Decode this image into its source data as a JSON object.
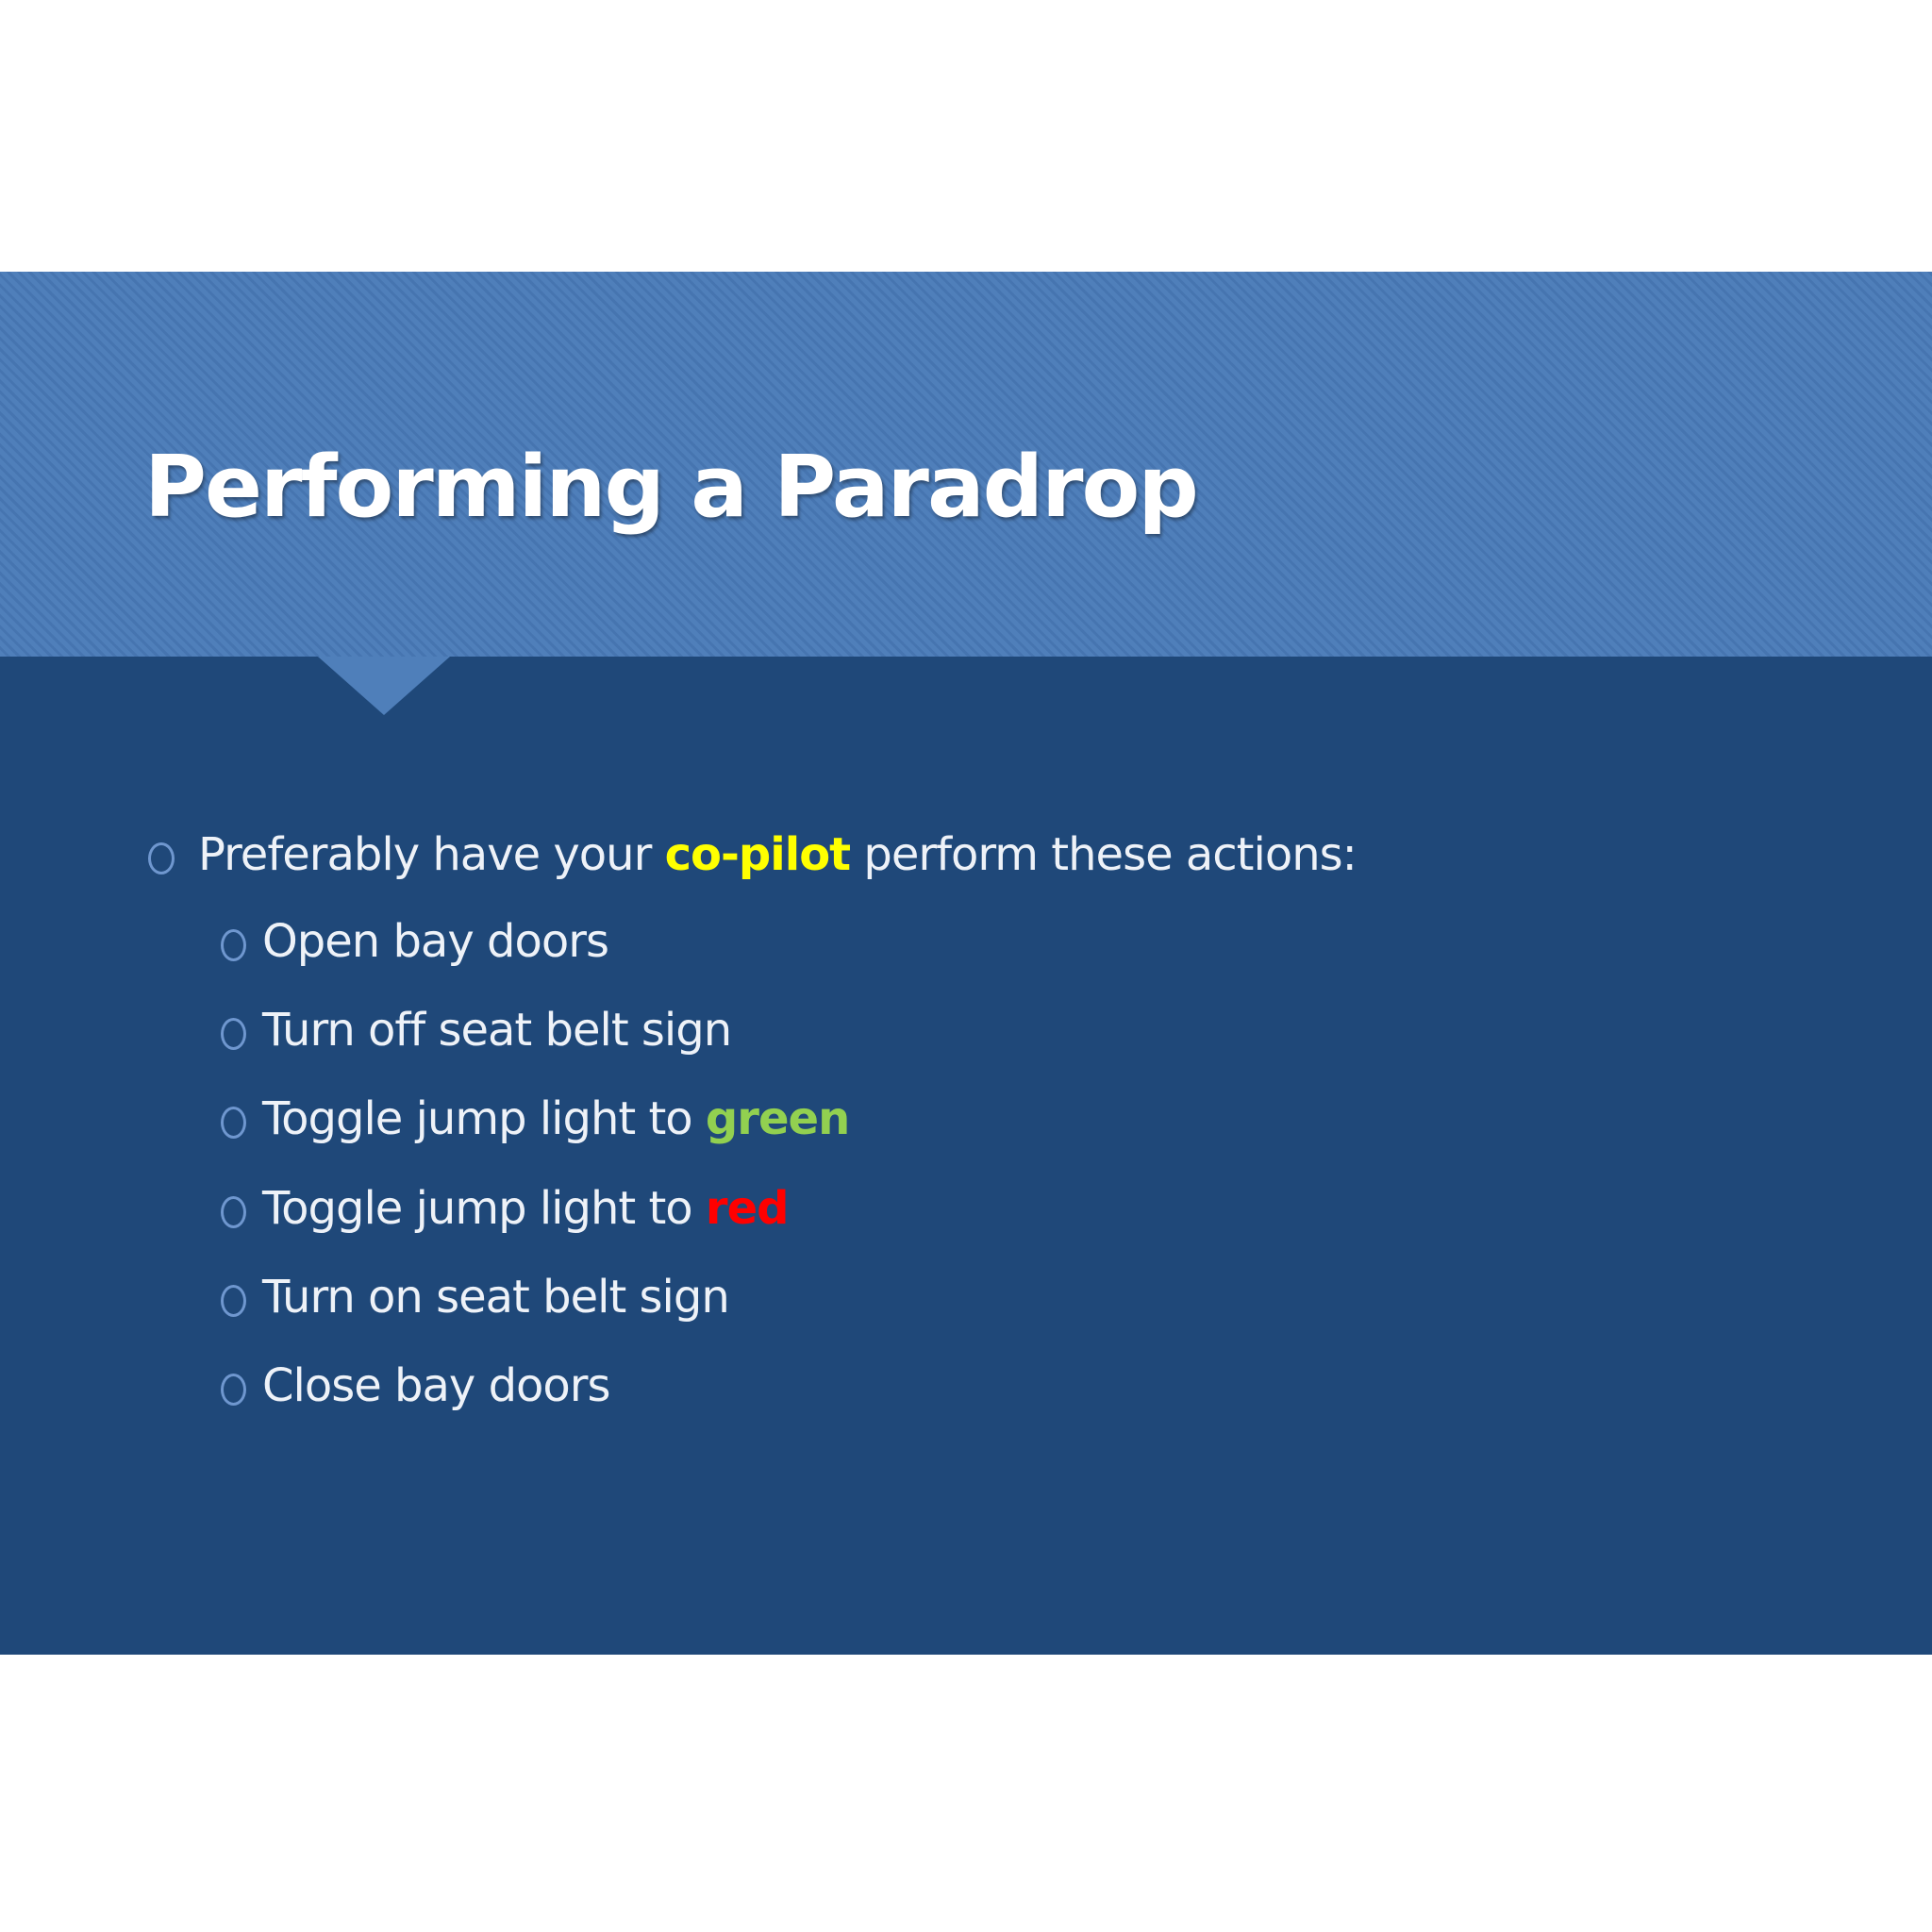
{
  "slide": {
    "title": "Performing a Paradrop",
    "colors": {
      "background": "#1f4879",
      "title_band": "#4f7fba",
      "text": "#eef2f8",
      "bullet": "#6f97cf",
      "highlight_yellow": "#ffff00",
      "highlight_green": "#92d050",
      "highlight_red": "#ff0000"
    },
    "main_bullet": {
      "before": "Preferably have your ",
      "highlight": "co-pilot",
      "after": " perform these actions:"
    },
    "sub_bullets": [
      {
        "text": "Open bay doors",
        "highlight": ""
      },
      {
        "text": "Turn off seat belt sign",
        "highlight": ""
      },
      {
        "text": "Toggle jump light to ",
        "highlight": "green"
      },
      {
        "text": "Toggle jump light to ",
        "highlight": "red"
      },
      {
        "text": "Turn on seat belt sign",
        "highlight": ""
      },
      {
        "text": "Close bay doors",
        "highlight": ""
      }
    ]
  }
}
